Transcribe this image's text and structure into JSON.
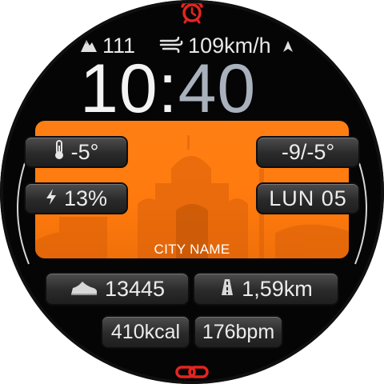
{
  "status": {
    "altitude": "111",
    "wind_speed": "109km/h"
  },
  "time": {
    "hours": "10",
    "separator": ":",
    "minutes": "40"
  },
  "weather": {
    "temperature": "-5°",
    "min_max": "-9/-5°",
    "city": "CITY NAME"
  },
  "battery": "13%",
  "date": "LUN 05",
  "activity": {
    "steps": "13445",
    "distance": "1,59km",
    "calories": "410kcal",
    "heart_rate": "176bpm"
  },
  "colors": {
    "accent": "#ff7a0e",
    "alarm_icon": "#e5241f",
    "link_icon": "#e5241f",
    "minutes": "#a9b1bd"
  },
  "icons": [
    "alarm-icon",
    "mountain-icon",
    "wind-icon",
    "direction-arrow-icon",
    "thermometer-icon",
    "bolt-icon",
    "shoe-icon",
    "road-icon",
    "link-icon"
  ]
}
